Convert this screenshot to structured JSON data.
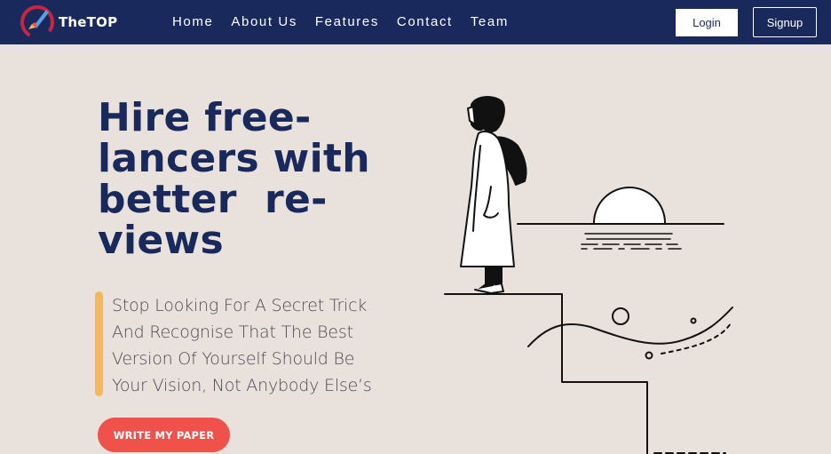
{
  "navbar": {
    "brand": "TheTOP",
    "links": [
      "Home",
      "About Us",
      "Features",
      "Contact",
      "Team"
    ],
    "login_label": "Login",
    "signup_label": "Signup"
  },
  "hero": {
    "title_lines": [
      "Hire free-",
      "lancers with",
      "better  re-",
      "views"
    ],
    "quote_lines": [
      "Stop Looking For A Secret Trick",
      "And Recognise That The Best",
      "Version Of Yourself Should Be",
      "Your Vision, Not Anybody Else’s"
    ],
    "cta_label": "WRITE MY PAPER"
  },
  "colors": {
    "navbar_bg": "#19295c",
    "page_bg": "#e9e2dc",
    "accent_red": "#f0524b",
    "accent_yellow": "#f5b75a",
    "title_blue": "#19295c"
  },
  "icons": {
    "logo": "brush-logo-icon",
    "illustration": "hiker-sunset-illustration"
  }
}
